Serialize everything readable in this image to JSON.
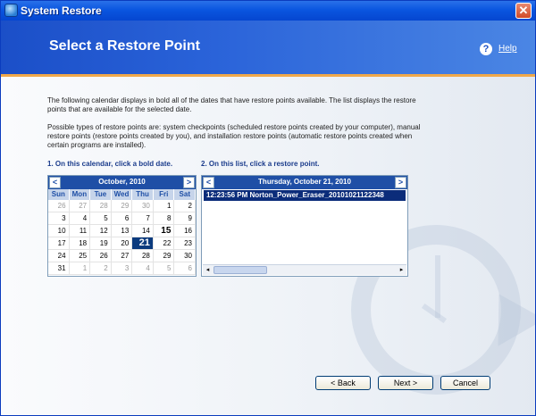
{
  "window": {
    "title": "System Restore",
    "close_glyph": "✕"
  },
  "header": {
    "heading": "Select a Restore Point",
    "help_label": "Help",
    "help_glyph": "?"
  },
  "intro": {
    "paragraph1": "The following calendar displays in bold all of the dates that have restore points available. The list displays the restore points that are available for the selected date.",
    "paragraph2": "Possible types of restore points are: system checkpoints (scheduled restore points created by your computer), manual restore points (restore points created by you), and installation restore points (automatic restore points created when certain programs are installed)."
  },
  "steps": {
    "calendar": "1. On this calendar, click a bold date.",
    "list": "2. On this list, click a restore point."
  },
  "calendar": {
    "month": "October, 2010",
    "prev_glyph": "<",
    "next_glyph": ">",
    "days_of_week": [
      "Sun",
      "Mon",
      "Tue",
      "Wed",
      "Thu",
      "Fri",
      "Sat"
    ],
    "days": [
      {
        "n": "26",
        "dim": true
      },
      {
        "n": "27",
        "dim": true
      },
      {
        "n": "28",
        "dim": true
      },
      {
        "n": "29",
        "dim": true
      },
      {
        "n": "30",
        "dim": true
      },
      {
        "n": "1"
      },
      {
        "n": "2"
      },
      {
        "n": "3"
      },
      {
        "n": "4"
      },
      {
        "n": "5"
      },
      {
        "n": "6"
      },
      {
        "n": "7"
      },
      {
        "n": "8"
      },
      {
        "n": "9"
      },
      {
        "n": "10"
      },
      {
        "n": "11"
      },
      {
        "n": "12"
      },
      {
        "n": "13"
      },
      {
        "n": "14"
      },
      {
        "n": "15",
        "bold": true
      },
      {
        "n": "16"
      },
      {
        "n": "17"
      },
      {
        "n": "18"
      },
      {
        "n": "19"
      },
      {
        "n": "20"
      },
      {
        "n": "21",
        "selected": true
      },
      {
        "n": "22"
      },
      {
        "n": "23"
      },
      {
        "n": "24"
      },
      {
        "n": "25"
      },
      {
        "n": "26"
      },
      {
        "n": "27"
      },
      {
        "n": "28"
      },
      {
        "n": "29"
      },
      {
        "n": "30"
      },
      {
        "n": "31"
      },
      {
        "n": "1",
        "dim": true
      },
      {
        "n": "2",
        "dim": true
      },
      {
        "n": "3",
        "dim": true
      },
      {
        "n": "4",
        "dim": true
      },
      {
        "n": "5",
        "dim": true
      },
      {
        "n": "6",
        "dim": true
      }
    ]
  },
  "restore_list": {
    "date": "Thursday, October 21, 2010",
    "prev_glyph": "<",
    "next_glyph": ">",
    "items": [
      "12:23:56 PM  Norton_Power_Eraser_20101021122348"
    ],
    "scroll_left": "◂",
    "scroll_right": "▸"
  },
  "buttons": {
    "back": "< Back",
    "next": "Next >",
    "cancel": "Cancel"
  }
}
